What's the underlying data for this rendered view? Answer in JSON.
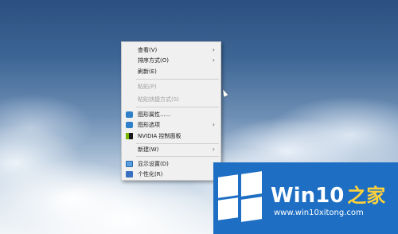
{
  "context_menu": {
    "items": [
      {
        "label": "查看(V)",
        "submenu": true,
        "enabled": true
      },
      {
        "label": "排序方式(O)",
        "submenu": true,
        "enabled": true
      },
      {
        "label": "刷新(E)",
        "submenu": false,
        "enabled": true
      },
      {
        "label": "粘贴(P)",
        "submenu": false,
        "enabled": false
      },
      {
        "label": "粘贴快捷方式(S)",
        "submenu": false,
        "enabled": false
      },
      {
        "label": "图形属性......",
        "submenu": false,
        "enabled": true,
        "icon": "intel-graphics-icon"
      },
      {
        "label": "图形选项",
        "submenu": true,
        "enabled": true,
        "icon": "intel-graphics-icon"
      },
      {
        "label": "NVIDIA 控制面板",
        "submenu": false,
        "enabled": true,
        "icon": "nvidia-icon"
      },
      {
        "label": "新建(W)",
        "submenu": true,
        "enabled": true
      },
      {
        "label": "显示设置(D)",
        "submenu": false,
        "enabled": true,
        "icon": "display-icon"
      },
      {
        "label": "个性化(R)",
        "submenu": false,
        "enabled": true,
        "icon": "personalize-icon"
      }
    ],
    "arrow_glyph": "›"
  },
  "watermark": {
    "title_main": "Win10",
    "title_accent": "之家",
    "url": "www.win10xitong.com"
  },
  "colors": {
    "menu_bg": "#f0f0f0",
    "disabled_text": "#a0a0a0",
    "badge_bg": "#1e6fc4",
    "accent_yellow": "#ffd23a"
  }
}
